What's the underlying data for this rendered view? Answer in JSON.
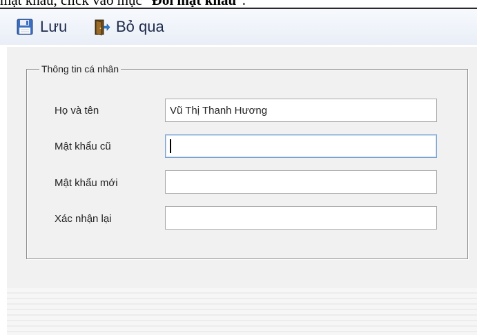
{
  "caption": {
    "prefix": "mật khẩu, click vào mục \"",
    "bold": "Đổi mật khẩu",
    "suffix": "\"."
  },
  "toolbar": {
    "save_label": "Lưu",
    "save_icon": "floppy-disk-icon",
    "skip_label": "Bỏ qua",
    "skip_icon": "exit-door-icon"
  },
  "personal_info": {
    "legend": "Thông tin cá nhân",
    "full_name_label": "Họ và tên",
    "full_name_value": "Vũ Thị Thanh Hương",
    "old_password_label": "Mật khẩu cũ",
    "old_password_value": "",
    "new_password_label": "Mật khẩu mới",
    "new_password_value": "",
    "confirm_label": "Xác nhận lại",
    "confirm_value": ""
  },
  "colors": {
    "toolbar_text": "#1d2a4a",
    "panel_bg": "#f1f1f1",
    "focus_border": "#7da2ce"
  }
}
